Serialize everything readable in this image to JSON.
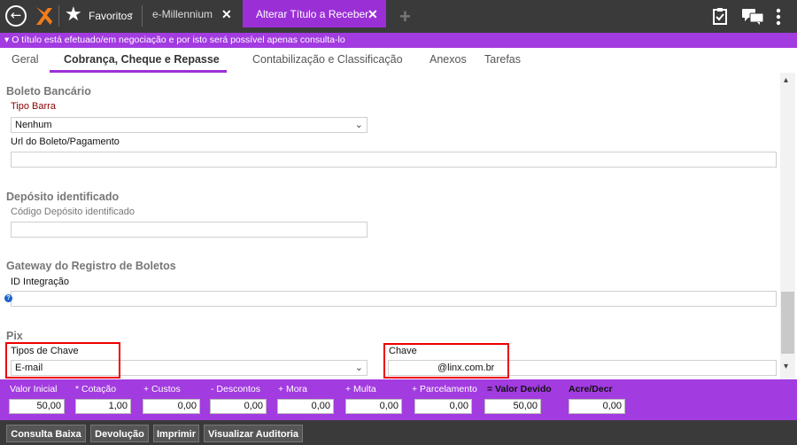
{
  "topbar": {
    "favorites_label": "Favoritos",
    "tabs": [
      {
        "label": "e-Millennium"
      },
      {
        "label": "Alterar Título a Receber"
      }
    ]
  },
  "notice": "▾ O título está efetuado/em negociação e por isto será possível apenas consulta-lo",
  "form_tabs": [
    {
      "label": "Geral"
    },
    {
      "label": "Cobrança, Cheque e Repasse"
    },
    {
      "label": "Contabilização e Classificação"
    },
    {
      "label": "Anexos"
    },
    {
      "label": "Tarefas"
    }
  ],
  "boleto": {
    "title": "Boleto Bancário",
    "tipo_barra_label": "Tipo Barra",
    "tipo_barra_value": "Nenhum",
    "url_label": "Url do Boleto/Pagamento",
    "url_value": ""
  },
  "deposito": {
    "title": "Depósito identificado",
    "codigo_label": "Código Depósito identificado",
    "codigo_value": ""
  },
  "gateway": {
    "title": "Gateway do Registro de Boletos",
    "id_label": "ID Integração",
    "id_value": ""
  },
  "pix": {
    "title": "Pix",
    "tipos_label": "Tipos de Chave",
    "tipos_value": "E-mail",
    "chave_label": "Chave",
    "chave_value": "@linx.com.br"
  },
  "totals": [
    {
      "label": "Valor Inicial",
      "value": "50,00"
    },
    {
      "label": "* Cotação",
      "value": "1,00"
    },
    {
      "label": "+ Custos",
      "value": "0,00"
    },
    {
      "label": "- Descontos",
      "value": "0,00"
    },
    {
      "label": "+ Mora",
      "value": "0,00"
    },
    {
      "label": "+ Multa",
      "value": "0,00"
    },
    {
      "label": "+ Parcelamento",
      "value": "0,00"
    },
    {
      "label": "= Valor Devido",
      "value": "50,00"
    },
    {
      "label": "Acre/Decr",
      "value": "0,00"
    }
  ],
  "buttons": [
    {
      "label": "Consulta Baixa"
    },
    {
      "label": "Devolução"
    },
    {
      "label": "Imprimir"
    },
    {
      "label": "Visualizar Auditoria"
    }
  ],
  "colors": {
    "accent": "#a23be0",
    "topbar": "#3a3a3a",
    "highlight": "#e00000"
  }
}
